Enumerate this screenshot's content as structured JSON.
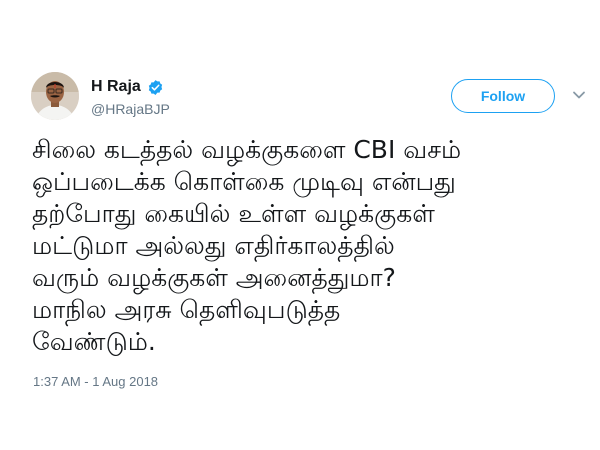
{
  "tweet": {
    "author": {
      "display_name": "H Raja",
      "handle": "@HRajaBJP",
      "verified": true,
      "avatar_icon": "profile-photo"
    },
    "follow_label": "Follow",
    "more_icon": "chevron-down-icon",
    "text": "சிலை கடத்தல் வழக்குகளை CBI வசம்\nஒப்படைக்க கொள்கை முடிவு என்பது\nதற்போது கையில் உள்ள வழக்குகள்\nமட்டுமா அல்லது எதிர்காலத்தில்\nவரும் வழக்குகள் அனைத்துமா?\nமாநில அரசு தெளிவுபடுத்த\nவேண்டும்.",
    "timestamp": "1:37 AM - 1 Aug 2018"
  },
  "colors": {
    "accent": "#1da1f2",
    "text_primary": "#14171a",
    "text_secondary": "#657786",
    "background": "#ffffff"
  }
}
